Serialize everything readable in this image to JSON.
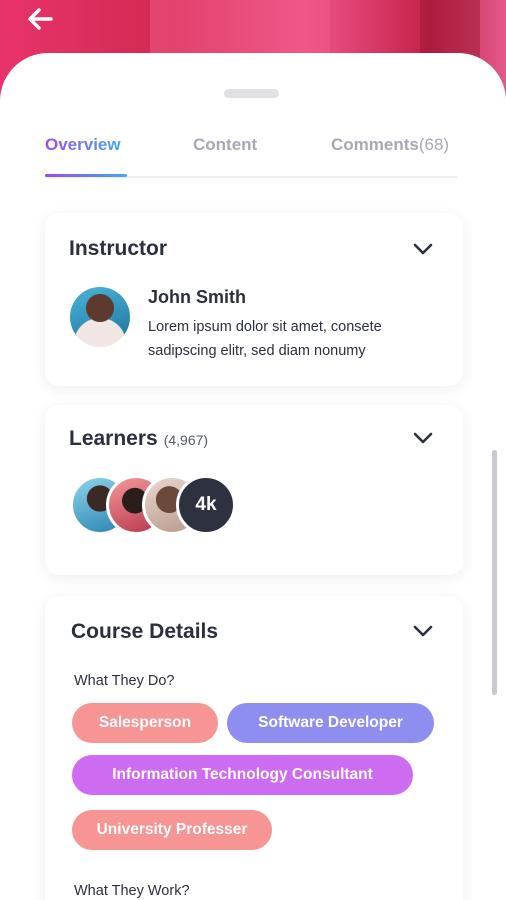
{
  "header": {
    "back_icon": "arrow-left-icon"
  },
  "tabs": [
    {
      "label": "Overview",
      "active": true
    },
    {
      "label": "Content",
      "active": false
    },
    {
      "label": "Comments",
      "count": "(68)",
      "active": false
    }
  ],
  "instructor": {
    "title": "Instructor",
    "name": "John Smith",
    "bio": "Lorem ipsum dolor sit amet, consete sadipscing elitr, sed diam nonumy"
  },
  "learners": {
    "title": "Learners",
    "count": "(4,967)",
    "more_label": "4k"
  },
  "course_details": {
    "title": "Course Details",
    "what_they_do_label": "What They Do?",
    "what_they_do": [
      "Salesperson",
      "Software Developer",
      "Information Technology Consultant",
      "University Professer"
    ],
    "what_they_work_label": "What They Work?"
  },
  "colors": {
    "accent_gradient_start": "#9b4de8",
    "accent_gradient_end": "#3fa9f5",
    "chip_pink": "#f79494",
    "chip_blue": "#8e8df0",
    "chip_purple": "#cd6cf1",
    "text_dark": "#2c2f3d"
  }
}
